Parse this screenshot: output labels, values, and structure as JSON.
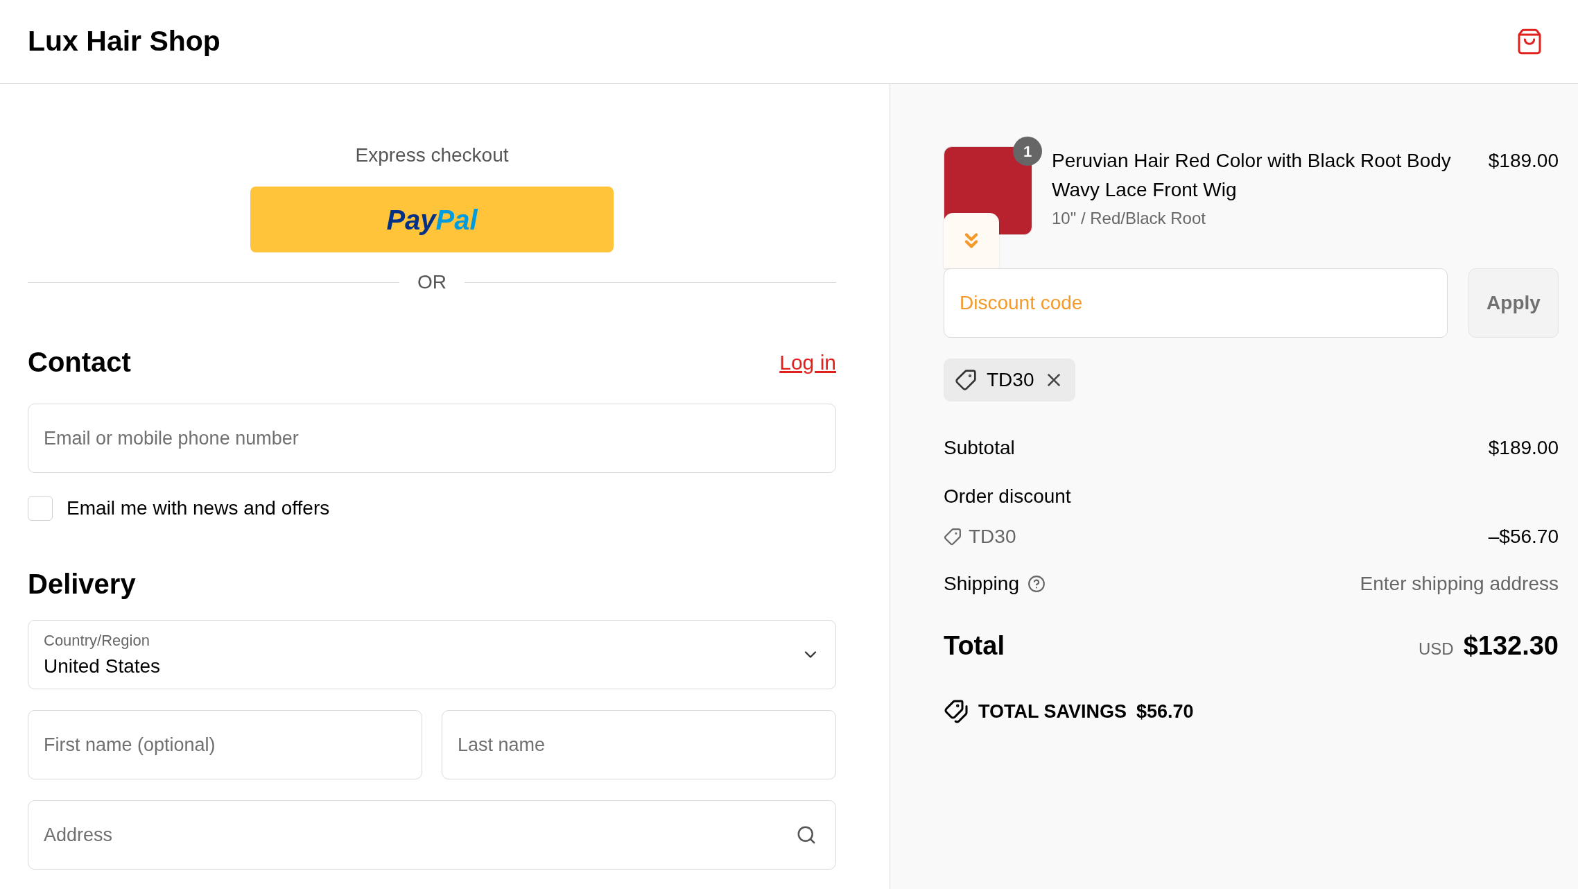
{
  "header": {
    "shop_name": "Lux Hair Shop"
  },
  "express": {
    "title": "Express checkout",
    "paypal": {
      "pay": "Pay",
      "pal": "Pal"
    },
    "divider": "OR"
  },
  "contact": {
    "heading": "Contact",
    "login_link": "Log in",
    "email": {
      "placeholder": "Email or mobile phone number"
    },
    "newsletter": {
      "label": "Email me with news and offers",
      "checked": false
    }
  },
  "delivery": {
    "heading": "Delivery",
    "country": {
      "label": "Country/Region",
      "value": "United States"
    },
    "first_name": {
      "placeholder": "First name (optional)"
    },
    "last_name": {
      "placeholder": "Last name"
    },
    "address": {
      "placeholder": "Address"
    }
  },
  "order": {
    "item": {
      "quantity": "1",
      "title": "Peruvian Hair Red Color with Black Root Body Wavy Lace Front Wig",
      "variant": "10\" / Red/Black Root",
      "price": "$189.00"
    },
    "discount": {
      "placeholder": "Discount code",
      "apply": "Apply",
      "applied_code": "TD30"
    },
    "subtotal": {
      "label": "Subtotal",
      "value": "$189.00"
    },
    "order_discount": {
      "label": "Order discount",
      "code": "TD30",
      "value": "–$56.70"
    },
    "shipping": {
      "label": "Shipping",
      "value": "Enter shipping address"
    },
    "total": {
      "label": "Total",
      "currency": "USD",
      "value": "$132.30"
    },
    "savings": {
      "label": "TOTAL SAVINGS",
      "value": "$56.70"
    }
  }
}
